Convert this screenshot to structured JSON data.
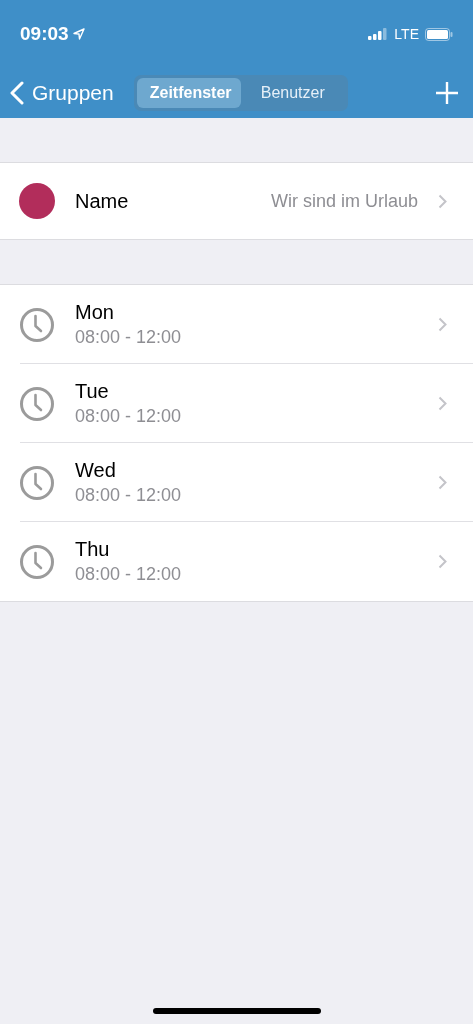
{
  "status_bar": {
    "time": "09:03",
    "network": "LTE"
  },
  "nav": {
    "back": "Gruppen",
    "tabs": [
      {
        "label": "Zeitfenster",
        "selected": true
      },
      {
        "label": "Benutzer",
        "selected": false
      }
    ]
  },
  "group": {
    "label": "Name",
    "value": "Wir sind im Urlaub",
    "color": "#b22d5b"
  },
  "time_windows": [
    {
      "day": "Mon",
      "range": "08:00 - 12:00"
    },
    {
      "day": "Tue",
      "range": "08:00 - 12:00"
    },
    {
      "day": "Wed",
      "range": "08:00 - 12:00"
    },
    {
      "day": "Thu",
      "range": "08:00 - 12:00"
    }
  ]
}
